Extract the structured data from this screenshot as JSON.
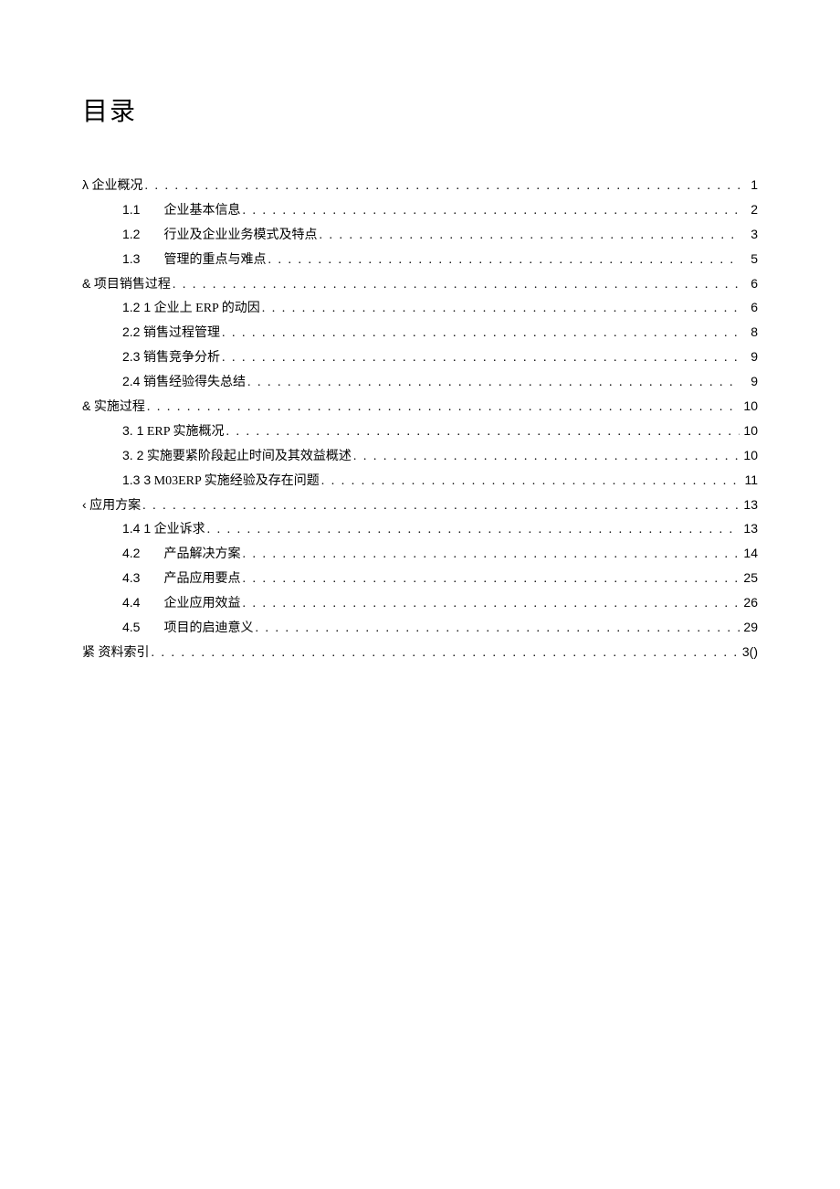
{
  "title": "目录",
  "entries": [
    {
      "level": 1,
      "num": "λ",
      "title": "企业概况",
      "page": "1",
      "numWide": false
    },
    {
      "level": 2,
      "num": "1.1",
      "title": "企业基本信息",
      "page": "2",
      "numWide": true
    },
    {
      "level": 2,
      "num": "1.2",
      "title": "行业及企业业务模式及特点",
      "page": "3",
      "numWide": true
    },
    {
      "level": 2,
      "num": "1.3",
      "title": "管理的重点与难点",
      "page": "5",
      "numWide": true
    },
    {
      "level": 1,
      "num": "&",
      "title": "项目销售过程",
      "page": "6",
      "numWide": false
    },
    {
      "level": 2,
      "num": "1.2 1",
      "title": "企业上 ERP 的动因",
      "page": "6",
      "numWide": false
    },
    {
      "level": 2,
      "num": "2.2",
      "title": "销售过程管理",
      "page": "8",
      "numWide": false
    },
    {
      "level": 2,
      "num": "2.3",
      "title": "销售竞争分析",
      "page": "9",
      "numWide": false
    },
    {
      "level": 2,
      "num": "2.4",
      "title": "销售经验得失总结",
      "page": "9",
      "numWide": false
    },
    {
      "level": 1,
      "num": "&",
      "title": "实施过程",
      "page": "10",
      "numWide": false
    },
    {
      "level": 2,
      "num": "3.   1",
      "title": "ERP 实施概况",
      "page": "10",
      "numWide": false
    },
    {
      "level": 2,
      "num": "3.   2",
      "title": "实施要紧阶段起止时间及其效益概述",
      "page": "10",
      "numWide": false
    },
    {
      "level": 2,
      "num": "1.3 3",
      "title": "M03ERP 实施经验及存在问题",
      "page": "11",
      "numWide": false
    },
    {
      "level": 1,
      "num": "‹",
      "title": "应用方案",
      "page": "13",
      "numWide": false
    },
    {
      "level": 2,
      "num": "1.4 1",
      "title": "企业诉求",
      "page": "13",
      "numWide": false
    },
    {
      "level": 2,
      "num": "4.2",
      "title": "产品解决方案",
      "page": "14",
      "numWide": true
    },
    {
      "level": 2,
      "num": "4.3",
      "title": "产品应用要点",
      "page": "25",
      "numWide": true
    },
    {
      "level": 2,
      "num": "4.4",
      "title": "企业应用效益",
      "page": "26",
      "numWide": true
    },
    {
      "level": 2,
      "num": "4.5",
      "title": "项目的启迪意义",
      "page": "29",
      "numWide": true
    },
    {
      "level": 1,
      "num": "紧",
      "title": "资料索引",
      "page": "3()",
      "numWide": false
    }
  ]
}
